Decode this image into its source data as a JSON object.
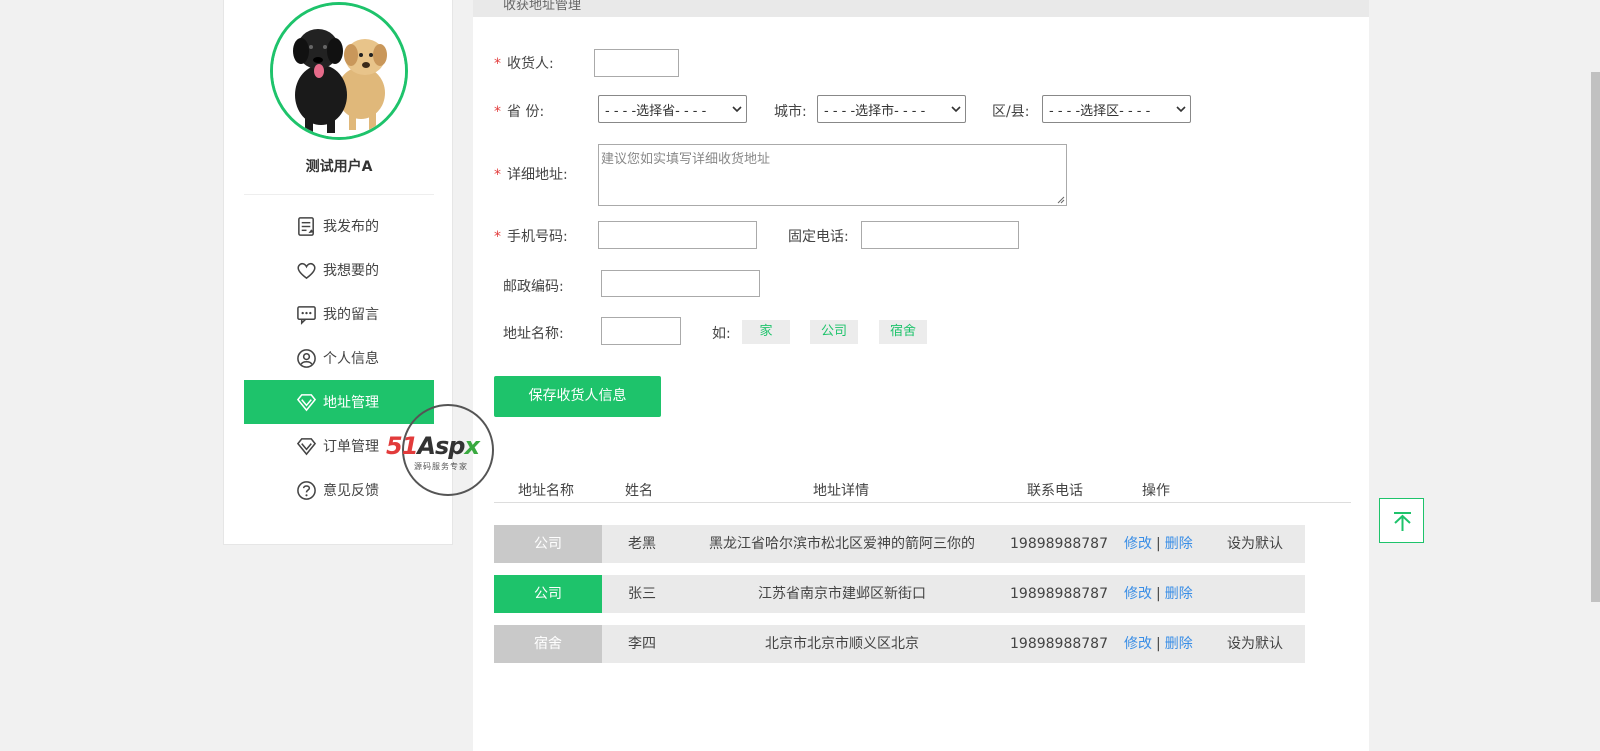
{
  "header": {
    "title": "收获地址管理"
  },
  "user": {
    "name": "测试用户A",
    "avatar_icon": "dogs-avatar"
  },
  "sidebar": {
    "items": [
      {
        "label": "我发布的",
        "icon": "document-list-icon",
        "active": false
      },
      {
        "label": "我想要的",
        "icon": "heart-icon",
        "active": false
      },
      {
        "label": "我的留言",
        "icon": "message-icon",
        "active": false
      },
      {
        "label": "个人信息",
        "icon": "user-circle-icon",
        "active": false
      },
      {
        "label": "地址管理",
        "icon": "diamond-icon",
        "active": true
      },
      {
        "label": "订单管理",
        "icon": "diamond-icon",
        "active": false
      },
      {
        "label": "意见反馈",
        "icon": "question-icon",
        "active": false
      }
    ]
  },
  "watermark": {
    "main_a": "51",
    "main_b": "Asp",
    "main_c": "x",
    "sub": "源码服务专家"
  },
  "form": {
    "required_mark": "*",
    "receiver_label": "收货人:",
    "receiver_value": "",
    "province_label": "省  份:",
    "province_value": "- - - -选择省- - - -",
    "city_label": "城市:",
    "city_value": "- - - -选择市- - - -",
    "district_label": "区/县:",
    "district_value": "- - - -选择区- - - -",
    "detail_label": "详细地址:",
    "detail_placeholder": "建议您如实填写详细收货地址",
    "mobile_label": "手机号码:",
    "mobile_value": "",
    "phone_label": "固定电话:",
    "phone_value": "",
    "postcode_label": "邮政编码:",
    "postcode_value": "",
    "addr_name_label": "地址名称:",
    "addr_name_value": "",
    "example_label": "如:",
    "tags": [
      "家",
      "公司",
      "宿舍"
    ],
    "save_label": "保存收货人信息"
  },
  "table": {
    "headers": [
      "地址名称",
      "姓名",
      "地址详情",
      "联系电话",
      "操作"
    ],
    "edit_label": "修改",
    "delete_label": "删除",
    "separator": "|",
    "rows": [
      {
        "tag": "公司",
        "name": "老黑",
        "address": "黑龙江省哈尔滨市松北区爱神的箭阿三你的",
        "phone": "19898988787",
        "set_default": "设为默认",
        "is_default": false
      },
      {
        "tag": "公司",
        "name": "张三",
        "address": "江苏省南京市建邺区新街口",
        "phone": "19898988787",
        "set_default": "",
        "is_default": true
      },
      {
        "tag": "宿舍",
        "name": "李四",
        "address": "北京市北京市顺义区北京",
        "phone": "19898988787",
        "set_default": "设为默认",
        "is_default": false
      }
    ]
  },
  "colors": {
    "accent": "#1ec36b",
    "link": "#3a8ee6",
    "required": "#e23b3b"
  }
}
